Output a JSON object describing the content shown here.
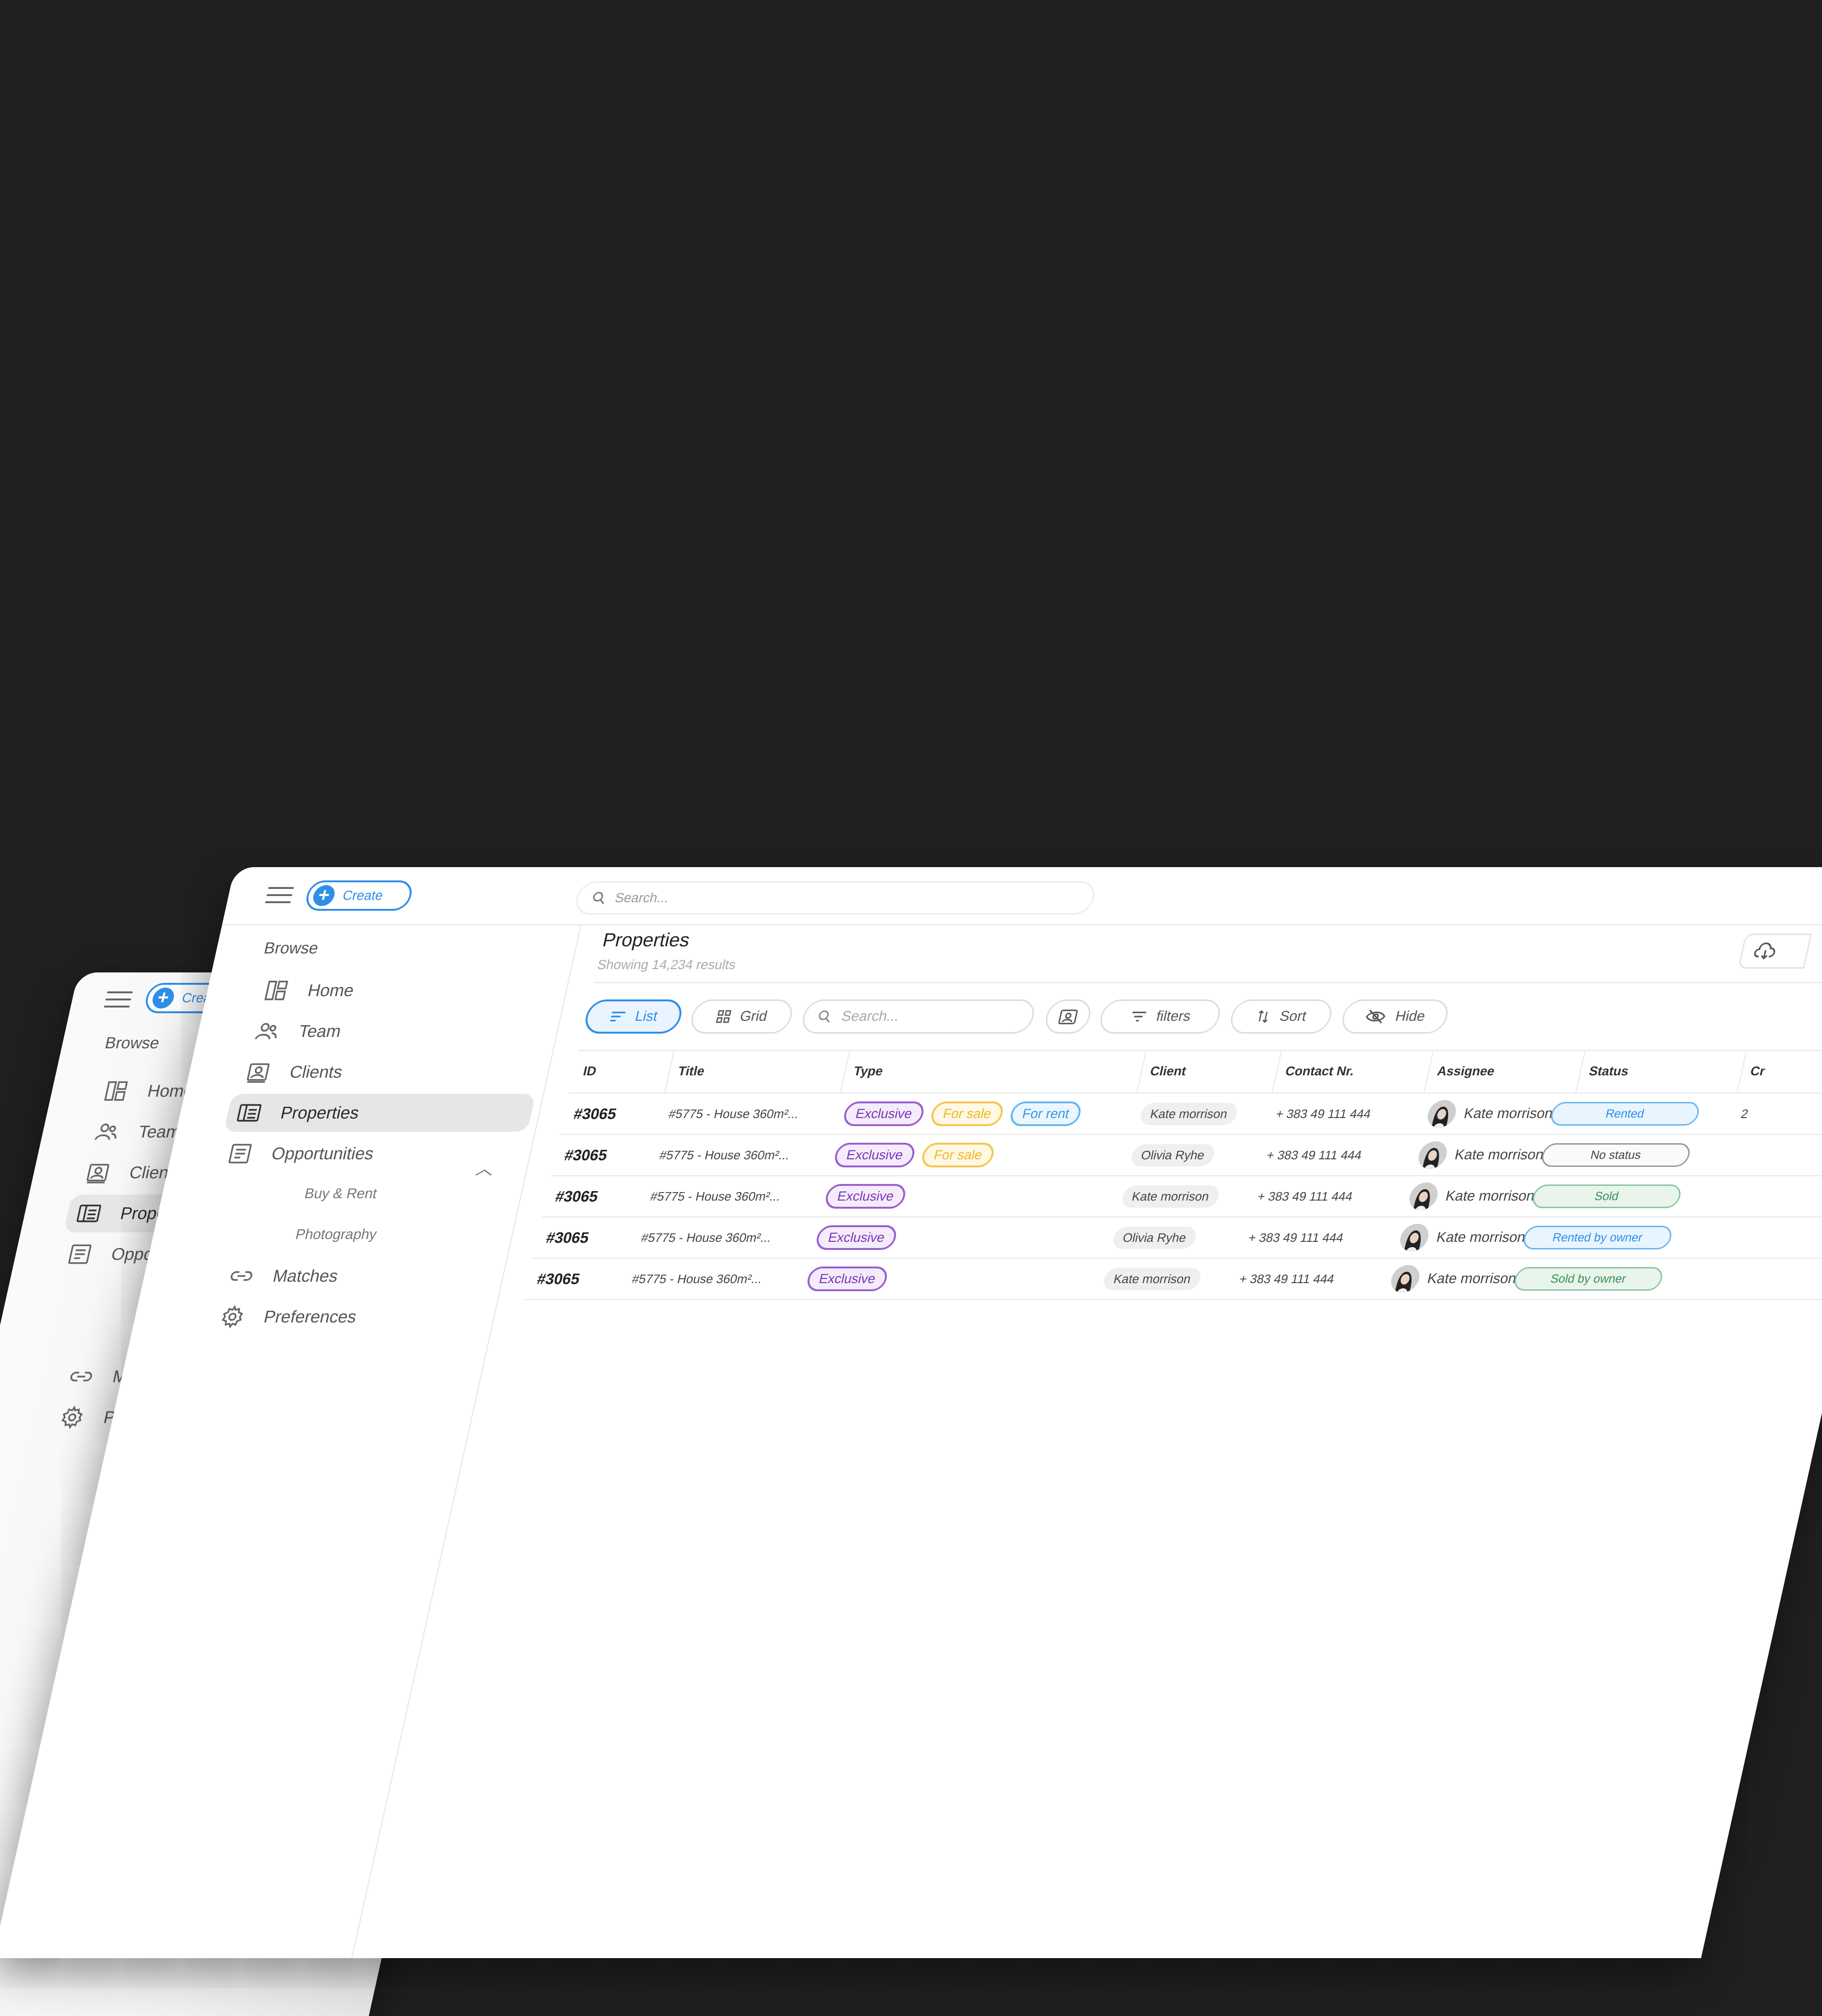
{
  "back_window": {
    "create_label": "Create",
    "browse_label": "Browse",
    "nav": [
      {
        "label": "Home",
        "icon": "dashboard-icon"
      },
      {
        "label": "Team",
        "icon": "team-icon"
      },
      {
        "label": "Clients",
        "icon": "clients-icon"
      },
      {
        "label": "Properties",
        "icon": "properties-icon",
        "active": true
      },
      {
        "label": "Opportunities",
        "icon": "opportunities-icon"
      }
    ],
    "sub": [
      "Buy & Rent",
      "Photography"
    ],
    "nav2": [
      {
        "label": "Matches",
        "icon": "link-icon"
      },
      {
        "label": "Preferences",
        "icon": "gear-icon"
      }
    ]
  },
  "topbar": {
    "create_label": "Create",
    "search_placeholder": "Search..."
  },
  "sidebar": {
    "browse_label": "Browse",
    "items": [
      {
        "label": "Home",
        "icon": "dashboard-icon"
      },
      {
        "label": "Team",
        "icon": "team-icon"
      },
      {
        "label": "Clients",
        "icon": "clients-icon"
      },
      {
        "label": "Properties",
        "icon": "properties-icon",
        "active": true
      },
      {
        "label": "Opportunities",
        "icon": "opportunities-icon"
      }
    ],
    "sub_items": [
      "Buy & Rent",
      "Photography"
    ],
    "bottom_items": [
      {
        "label": "Matches",
        "icon": "link-icon"
      },
      {
        "label": "Preferences",
        "icon": "gear-icon"
      }
    ]
  },
  "main": {
    "title": "Properties",
    "subtitle": "Showing 14,234 results",
    "toolbar": {
      "list_label": "List",
      "grid_label": "Grid",
      "search_placeholder": "Search...",
      "filters_label": "filters",
      "sort_label": "Sort",
      "hide_label": "Hide"
    },
    "table": {
      "columns": [
        "ID",
        "Title",
        "Type",
        "Client",
        "Contact Nr.",
        "Assignee",
        "Status",
        "Cr"
      ],
      "rows": [
        {
          "id": "#3065",
          "title": "#5775 - House 360m²...",
          "types": [
            "Exclusive",
            "For sale",
            "For rent"
          ],
          "client": "Kate morrison",
          "contact": "+ 383 49 111 444",
          "assignee": "Kate morrison",
          "status": "Rented",
          "created": "2"
        },
        {
          "id": "#3065",
          "title": "#5775 - House 360m²...",
          "types": [
            "Exclusive",
            "For sale"
          ],
          "client": "Olivia Ryhe",
          "contact": "+ 383 49 111 444",
          "assignee": "Kate morrison",
          "status": "No status",
          "created": ""
        },
        {
          "id": "#3065",
          "title": "#5775 - House 360m²...",
          "types": [
            "Exclusive"
          ],
          "client": "Kate morrison",
          "contact": "+ 383 49 111 444",
          "assignee": "Kate morrison",
          "status": "Sold",
          "created": ""
        },
        {
          "id": "#3065",
          "title": "#5775 - House 360m²...",
          "types": [
            "Exclusive"
          ],
          "client": "Olivia Ryhe",
          "contact": "+ 383 49 111 444",
          "assignee": "Kate morrison",
          "status": "Rented by owner",
          "created": ""
        },
        {
          "id": "#3065",
          "title": "#5775 - House 360m²...",
          "types": [
            "Exclusive"
          ],
          "client": "Kate morrison",
          "contact": "+ 383 49 111 444",
          "assignee": "Kate morrison",
          "status": "Sold by owner",
          "created": ""
        }
      ]
    }
  },
  "colors": {
    "accent": "#2f8fe8",
    "exclusive": "#7a36b6",
    "for_sale": "#eeb825",
    "for_rent": "#3499e3",
    "status_rented": "#68b7ee",
    "status_none": "#9a9a9a",
    "status_sold": "#7bbf8e"
  }
}
